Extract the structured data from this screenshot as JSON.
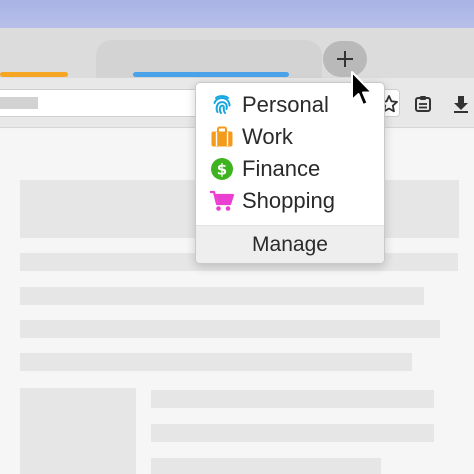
{
  "menu": {
    "items": [
      {
        "label": "Personal",
        "icon": "fingerprint-icon",
        "color": "#18a6e0"
      },
      {
        "label": "Work",
        "icon": "briefcase-icon",
        "color": "#f59b1b"
      },
      {
        "label": "Finance",
        "icon": "dollar-icon",
        "color": "#3fb31f"
      },
      {
        "label": "Shopping",
        "icon": "cart-icon",
        "color": "#ea3fd0"
      }
    ],
    "manage_label": "Manage"
  },
  "new_tab": {
    "label": "+"
  },
  "colors": {
    "titlebar": "#a9b4e6",
    "tab_indicator_orange": "#f5a623",
    "tab_indicator_blue": "#4aa3ea"
  }
}
